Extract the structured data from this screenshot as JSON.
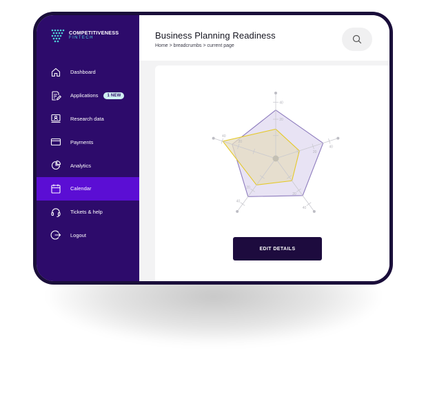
{
  "app": {
    "logo": {
      "line1": "COMPETITIVENESS",
      "line2": "FINTECH"
    }
  },
  "sidebar": {
    "items": [
      {
        "label": "Dashboard",
        "icon": "home-icon"
      },
      {
        "label": "Applications",
        "icon": "edit-document-icon",
        "badge": "1 NEW"
      },
      {
        "label": "Research data",
        "icon": "monitor-user-icon"
      },
      {
        "label": "Payments",
        "icon": "credit-card-icon"
      },
      {
        "label": "Analytics",
        "icon": "pie-chart-icon"
      },
      {
        "label": "Calendar",
        "icon": "calendar-icon",
        "active": true
      },
      {
        "label": "Tickets & help",
        "icon": "headset-icon"
      },
      {
        "label": "Logout",
        "icon": "logout-icon"
      }
    ]
  },
  "header": {
    "title": "Business Planning Readiness",
    "breadcrumb": "Home > breadcrumbs > current page",
    "search_icon": "search-icon"
  },
  "card": {
    "button_label": "EDIT DETAILS"
  },
  "colors": {
    "sidebar_bg": "#2d0b6b",
    "active_item": "#5b0ed4",
    "badge_bg": "#cfeff2",
    "button_bg": "#1d0b3e",
    "radar_outer_fill": "#e6e0f3",
    "radar_outer_stroke": "#8d7bbd",
    "radar_inner_fill": "#e5dcc2",
    "radar_inner_stroke": "#e5c92a"
  },
  "chart_data": {
    "type": "radar",
    "axes": 5,
    "tick_labels": [
      "20",
      "40"
    ],
    "series": [
      {
        "values": [
          0.74,
          0.76,
          0.7,
          0.72,
          0.7
        ]
      },
      {
        "values": [
          0.45,
          0.38,
          0.42,
          0.5,
          0.85
        ]
      }
    ]
  }
}
